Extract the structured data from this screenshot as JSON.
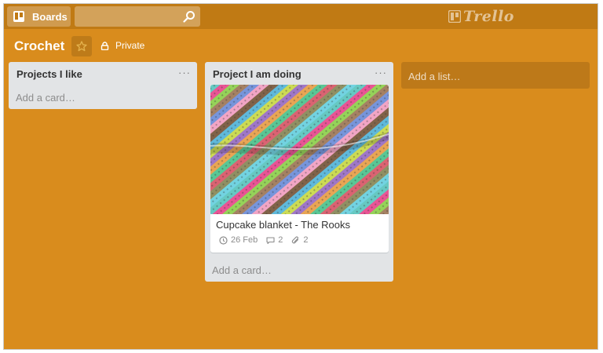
{
  "header": {
    "boards_label": "Boards",
    "search_value": "",
    "logo_text": "Trello"
  },
  "board": {
    "title": "Crochet",
    "visibility": "Private"
  },
  "lists": [
    {
      "title": "Projects I like",
      "menu": "···",
      "add_card": "Add a card…"
    },
    {
      "title": "Project I am doing",
      "menu": "···",
      "add_card": "Add a card…",
      "cards": [
        {
          "title": "Cupcake blanket - The Rooks",
          "due": "26 Feb",
          "comments": "2",
          "attachments": "2"
        }
      ]
    }
  ],
  "add_list": "Add a list…",
  "colors": {
    "background": "#d98c1d",
    "header": "#c07a14",
    "list": "#e2e4e6"
  },
  "icons": [
    "boards-icon",
    "search-icon",
    "trello-logo-icon",
    "star-icon",
    "lock-icon",
    "clock-icon",
    "comment-icon",
    "attachment-icon"
  ]
}
